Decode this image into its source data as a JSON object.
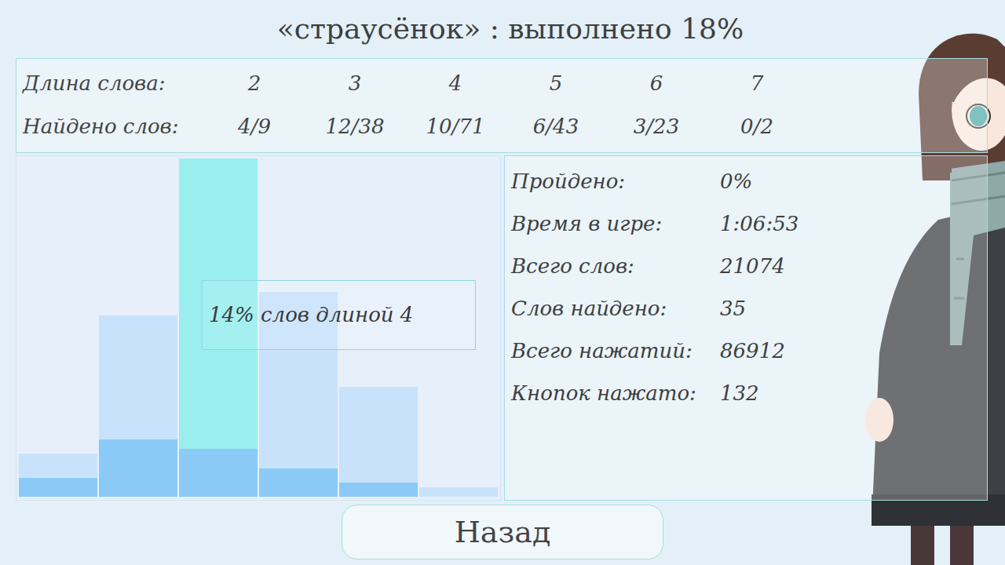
{
  "title": "«страусёнок» : выполнено 18%",
  "length_table": {
    "row_labels": [
      "Длина слова:",
      "Найдено слов:"
    ],
    "columns": [
      {
        "length": "2",
        "found": "4/9"
      },
      {
        "length": "3",
        "found": "12/38"
      },
      {
        "length": "4",
        "found": "10/71"
      },
      {
        "length": "5",
        "found": "6/43"
      },
      {
        "length": "6",
        "found": "3/23"
      },
      {
        "length": "7",
        "found": "0/2"
      }
    ]
  },
  "chart": {
    "series": {
      "total": [
        9,
        38,
        71,
        43,
        23,
        2
      ],
      "found": [
        4,
        12,
        10,
        6,
        3,
        0
      ]
    },
    "bars": [
      {
        "selected": false
      },
      {
        "selected": false
      },
      {
        "selected": true
      },
      {
        "selected": false
      },
      {
        "selected": false
      },
      {
        "selected": false
      }
    ],
    "tooltip": "14% слов длиной 4"
  },
  "stats": [
    {
      "label": "Пройдено:",
      "value": "0%"
    },
    {
      "label": "Время в игре:",
      "value": "1:06:53"
    },
    {
      "label": "Всего слов:",
      "value": "21074"
    },
    {
      "label": "Слов найдено:",
      "value": "35"
    },
    {
      "label": "Всего нажатий:",
      "value": "86912"
    },
    {
      "label": "Кнопок нажато:",
      "value": "132"
    }
  ],
  "buttons": [
    "Назад"
  ]
}
